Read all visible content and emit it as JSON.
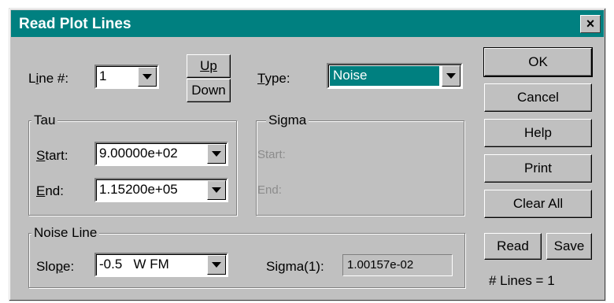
{
  "window": {
    "title": "Read Plot Lines",
    "close_glyph": "×"
  },
  "line": {
    "label": "Line #:",
    "value": "1"
  },
  "buttons": {
    "up": "Up",
    "down": "Down",
    "ok": "OK",
    "cancel": "Cancel",
    "help": "Help",
    "print": "Print",
    "clear_all": "Clear All",
    "read": "Read",
    "save": "Save"
  },
  "type": {
    "label": "Type:",
    "value": "Noise"
  },
  "tau": {
    "title": "Tau",
    "start_label": "Start:",
    "start_value": "9.00000e+02",
    "end_label": "End:",
    "end_value": "1.15200e+05"
  },
  "sigma": {
    "title": "Sigma",
    "start_label": "Start:",
    "end_label": "End:"
  },
  "noise_line": {
    "title": "Noise Line",
    "slope_label": "Slope:",
    "slope_value": "-0.5   W FM",
    "sigma1_label": "Sigma(1):",
    "sigma1_value": "1.00157e-02"
  },
  "status": {
    "lines_count": "# Lines = 1"
  },
  "colors": {
    "titlebar": "#008080",
    "face": "#c0c0c0",
    "selection": "#008080"
  }
}
